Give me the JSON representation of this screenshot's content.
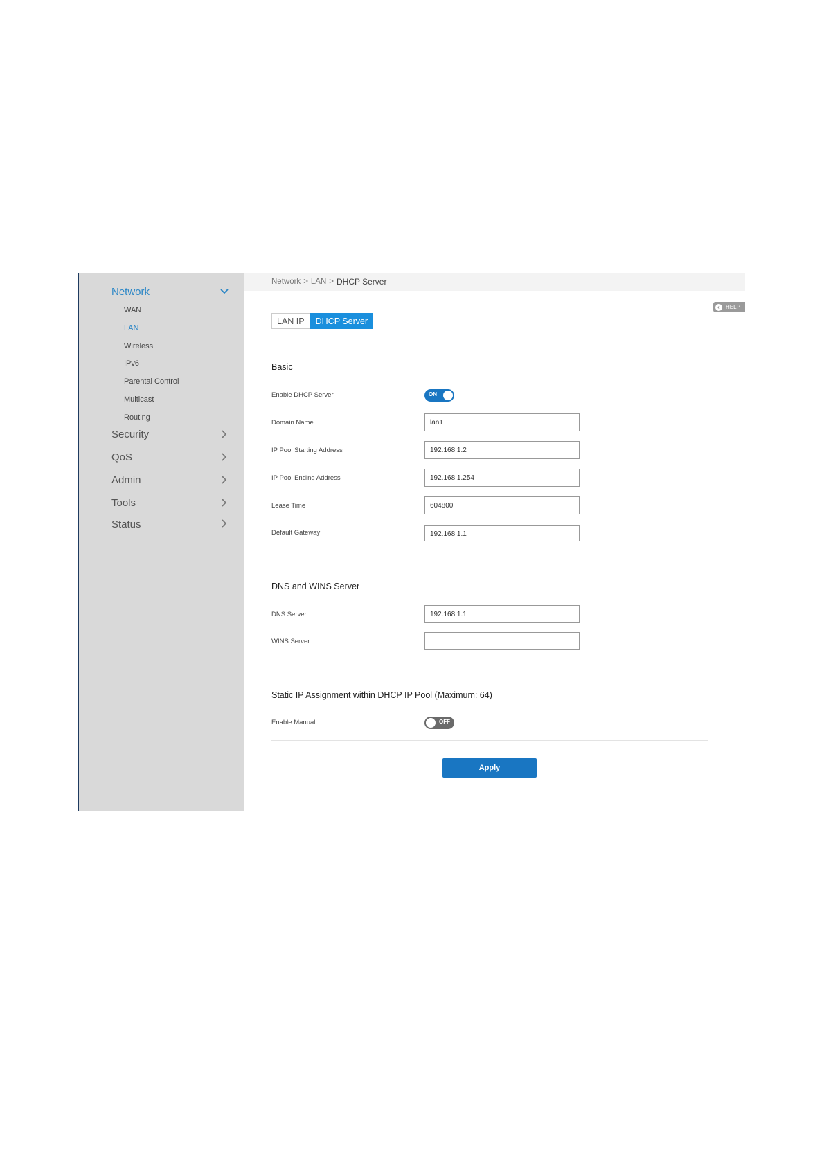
{
  "sidebar": {
    "network": {
      "label": "Network"
    },
    "sub_items": [
      "WAN",
      "LAN",
      "Wireless",
      "IPv6",
      "Parental Control",
      "Multicast",
      "Routing"
    ],
    "security": {
      "label": "Security"
    },
    "qos": {
      "label": "QoS"
    },
    "admin": {
      "label": "Admin"
    },
    "tools": {
      "label": "Tools"
    },
    "status": {
      "label": "Status"
    }
  },
  "breadcrumb": {
    "part1": "Network",
    "part2": "LAN",
    "current": "DHCP Server",
    "separator": ">"
  },
  "help": {
    "label": "HELP"
  },
  "tabs": [
    {
      "label": "LAN IP"
    },
    {
      "label": "DHCP Server",
      "selected": true
    }
  ],
  "basic": {
    "title": "Basic",
    "enable_dhcp": {
      "label": "Enable DHCP Server",
      "state": "ON"
    },
    "domain_name": {
      "label": "Domain Name",
      "value": "lan1"
    },
    "pool_start": {
      "label": "IP Pool Starting Address",
      "value": "192.168.1.2"
    },
    "pool_end": {
      "label": "IP Pool Ending Address",
      "value": "192.168.1.254"
    },
    "lease_time": {
      "label": "Lease Time",
      "value": "604800"
    },
    "gateway": {
      "label": "Default Gateway",
      "value": "192.168.1.1"
    }
  },
  "dns": {
    "title": "DNS and WINS Server",
    "dns_server": {
      "label": "DNS Server",
      "value": "192.168.1.1"
    },
    "wins_server": {
      "label": "WINS Server",
      "value": ""
    }
  },
  "static": {
    "title": "Static IP Assignment within DHCP IP Pool (Maximum: 64)",
    "enable_manual": {
      "label": "Enable Manual",
      "state": "OFF"
    }
  },
  "apply": {
    "label": "Apply"
  },
  "colors": {
    "accent": "#1976c2",
    "tab_selected": "#1a8fdd",
    "sidebar_bg": "#d9d9d9",
    "nav_active": "#2a86c6"
  },
  "icons": {
    "expanded": "chevron-down-icon",
    "collapsed": "chevron-right-icon",
    "help": "help-arrow-icon"
  }
}
